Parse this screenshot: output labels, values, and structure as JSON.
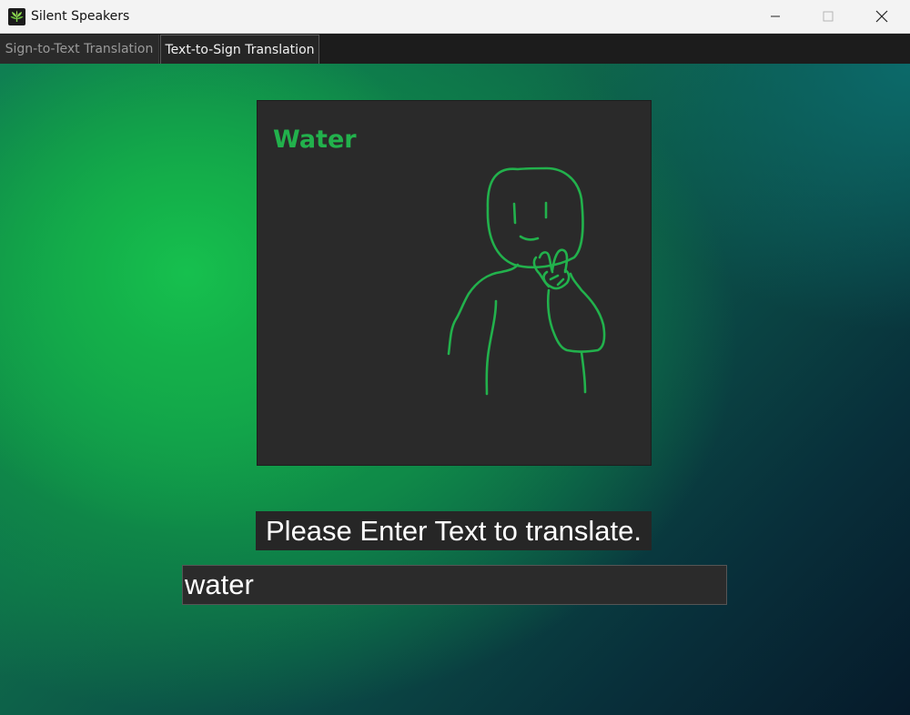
{
  "window": {
    "title": "Silent Speakers",
    "icon": "app-leaf-icon",
    "controls": {
      "minimize": "minimize-icon",
      "maximize": "maximize-icon",
      "close": "close-icon"
    }
  },
  "tabs": [
    {
      "label": "Sign-to-Text Translation",
      "active": false
    },
    {
      "label": "Text-to-Sign Translation",
      "active": true
    }
  ],
  "sign_card": {
    "word": "Water",
    "illustration": "sign-drawing-water"
  },
  "prompt": {
    "label": "Please Enter Text to translate."
  },
  "input": {
    "value": "water"
  },
  "colors": {
    "accent": "#22b14c",
    "panel": "#2a2a2a",
    "titlebar": "#f3f3f3"
  }
}
